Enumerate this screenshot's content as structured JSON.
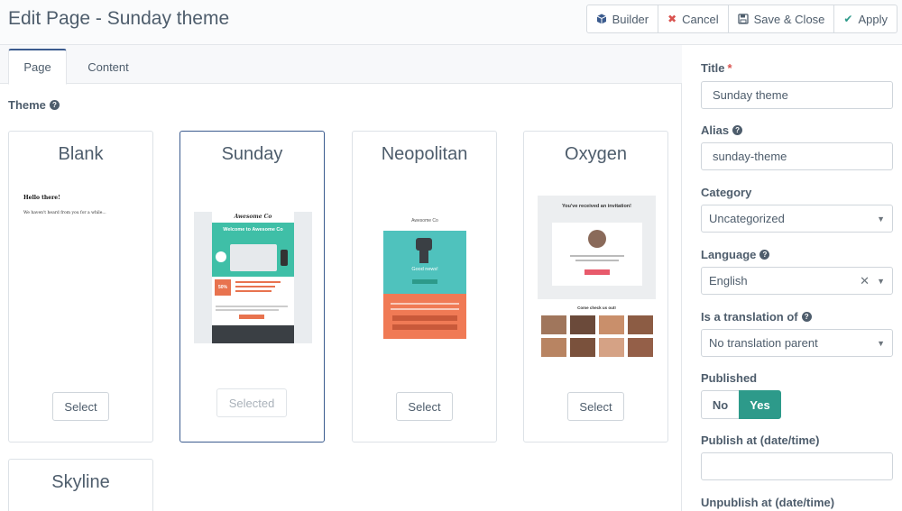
{
  "header": {
    "title": "Edit Page - Sunday theme",
    "buttons": {
      "builder": "Builder",
      "cancel": "Cancel",
      "save_close": "Save & Close",
      "apply": "Apply"
    }
  },
  "tabs": {
    "page": "Page",
    "content": "Content"
  },
  "theme": {
    "label": "Theme",
    "cards": [
      {
        "name": "Blank",
        "button": "Select",
        "preview_heading": "Hello there!",
        "preview_text": "We haven't heard from you for a while..."
      },
      {
        "name": "Sunday",
        "button": "Selected",
        "preview_brand": "Awesome Co",
        "preview_heading": "Welcome to Awesome Co",
        "preview_offer": "50%"
      },
      {
        "name": "Neopolitan",
        "button": "Select",
        "preview_brand": "Awesome Co",
        "preview_heading": "Good news!"
      },
      {
        "name": "Oxygen",
        "button": "Select",
        "preview_heading": "You've received an invitation!",
        "preview_footer": "Come check us out!"
      },
      {
        "name": "Skyline"
      }
    ]
  },
  "form": {
    "title": {
      "label": "Title",
      "required": "*",
      "value": "Sunday theme"
    },
    "alias": {
      "label": "Alias",
      "value": "sunday-theme"
    },
    "category": {
      "label": "Category",
      "value": "Uncategorized"
    },
    "language": {
      "label": "Language",
      "value": "English"
    },
    "translation": {
      "label": "Is a translation of",
      "value": "No translation parent"
    },
    "published": {
      "label": "Published",
      "no": "No",
      "yes": "Yes"
    },
    "publish_at": {
      "label": "Publish at (date/time)",
      "value": ""
    },
    "unpublish_at": {
      "label": "Unpublish at (date/time)"
    }
  },
  "colors": {
    "primary": "#3b5b8e",
    "accent": "#2d9a8a",
    "danger": "#d9534f"
  }
}
